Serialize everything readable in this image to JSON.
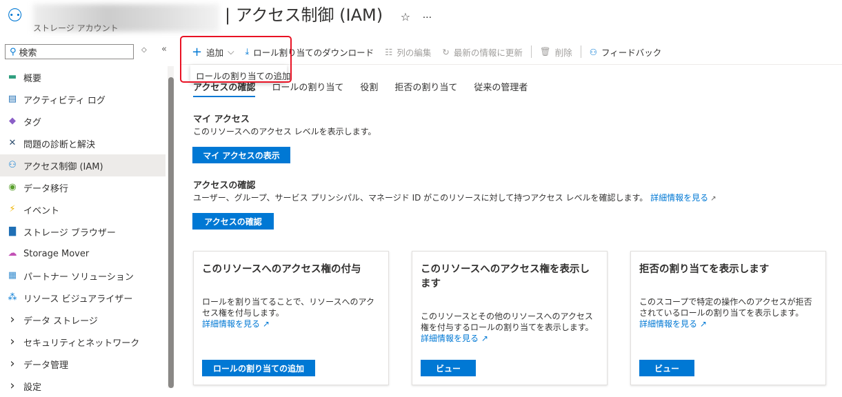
{
  "header": {
    "title": "| アクセス制御 (IAM)",
    "subtitle": "ストレージ アカウント",
    "favorite": "☆",
    "more": "···"
  },
  "sidebar": {
    "search_placeholder": "検索",
    "items": [
      {
        "label": "概要",
        "icon": "overview-icon",
        "glyph": "▬",
        "color": "#2e9e7e"
      },
      {
        "label": "アクティビティ ログ",
        "icon": "activity-log-icon",
        "glyph": "▤",
        "color": "#1f6fb5"
      },
      {
        "label": "タグ",
        "icon": "tag-icon",
        "glyph": "◆",
        "color": "#8b5fc7"
      },
      {
        "label": "問題の診断と解決",
        "icon": "wrench-icon",
        "glyph": "✕",
        "color": "#2f4f6f"
      },
      {
        "label": "アクセス制御 (IAM)",
        "icon": "iam-icon",
        "glyph": "⚇",
        "color": "#0078d4",
        "active": true
      },
      {
        "label": "データ移行",
        "icon": "data-migration-icon",
        "glyph": "◉",
        "color": "#5ba02f"
      },
      {
        "label": "イベント",
        "icon": "event-icon",
        "glyph": "⚡",
        "color": "#f0b400"
      },
      {
        "label": "ストレージ ブラウザー",
        "icon": "storage-browser-icon",
        "glyph": "▇",
        "color": "#1f6fb5"
      },
      {
        "label": "Storage Mover",
        "icon": "storage-mover-icon",
        "glyph": "☁",
        "color": "#c250b5"
      },
      {
        "label": "パートナー ソリューション",
        "icon": "partner-icon",
        "glyph": "▦",
        "color": "#3a8fd0"
      },
      {
        "label": "リソース ビジュアライザー",
        "icon": "visualizer-icon",
        "glyph": "⁂",
        "color": "#0078d4"
      },
      {
        "label": "データ ストレージ",
        "icon": "chevron-right-icon",
        "glyph": "›",
        "color": "#323130"
      },
      {
        "label": "セキュリティとネットワーク",
        "icon": "chevron-right-icon",
        "glyph": "›",
        "color": "#323130"
      },
      {
        "label": "データ管理",
        "icon": "chevron-right-icon",
        "glyph": "›",
        "color": "#323130"
      },
      {
        "label": "設定",
        "icon": "chevron-right-icon",
        "glyph": "›",
        "color": "#323130"
      }
    ]
  },
  "toolbar": {
    "add": "追加",
    "download": "ロール割り当てのダウンロード",
    "edit_columns": "列の編集",
    "refresh": "最新の情報に更新",
    "delete": "削除",
    "feedback": "フィードバック"
  },
  "dropdown": {
    "add_role_assignment": "ロールの割り当ての追加"
  },
  "tabs": [
    "アクセスの確認",
    "ロールの割り当て",
    "役割",
    "拒否の割り当て",
    "従来の管理者"
  ],
  "my_access": {
    "title": "マイ アクセス",
    "desc": "このリソースへのアクセス レベルを表示します。",
    "button": "マイ アクセスの表示"
  },
  "check_access": {
    "title": "アクセスの確認",
    "desc": "ユーザー、グループ、サービス プリンシパル、マネージド ID がこのリソースに対して持つアクセス レベルを確認します。",
    "link": "詳細情報を見る",
    "button": "アクセスの確認"
  },
  "cards": [
    {
      "title": "このリソースへのアクセス権の付与",
      "desc": "ロールを割り当てることで、リソースへのアクセス権を付与します。",
      "link": "詳細情報を見る",
      "button": "ロールの割り当ての追加"
    },
    {
      "title": "このリソースへのアクセス権を表示します",
      "desc": "このリソースとその他のリソースへのアクセス権を付与するロールの割り当てを表示します。",
      "link": "詳細情報を見る",
      "button": "ビュー"
    },
    {
      "title": "拒否の割り当てを表示します",
      "desc": "このスコープで特定の操作へのアクセスが拒否されているロールの割り当てを表示します。",
      "link": "詳細情報を見る",
      "button": "ビュー"
    }
  ],
  "colors": {
    "accent": "#0078d4",
    "highlight": "#e81123"
  }
}
